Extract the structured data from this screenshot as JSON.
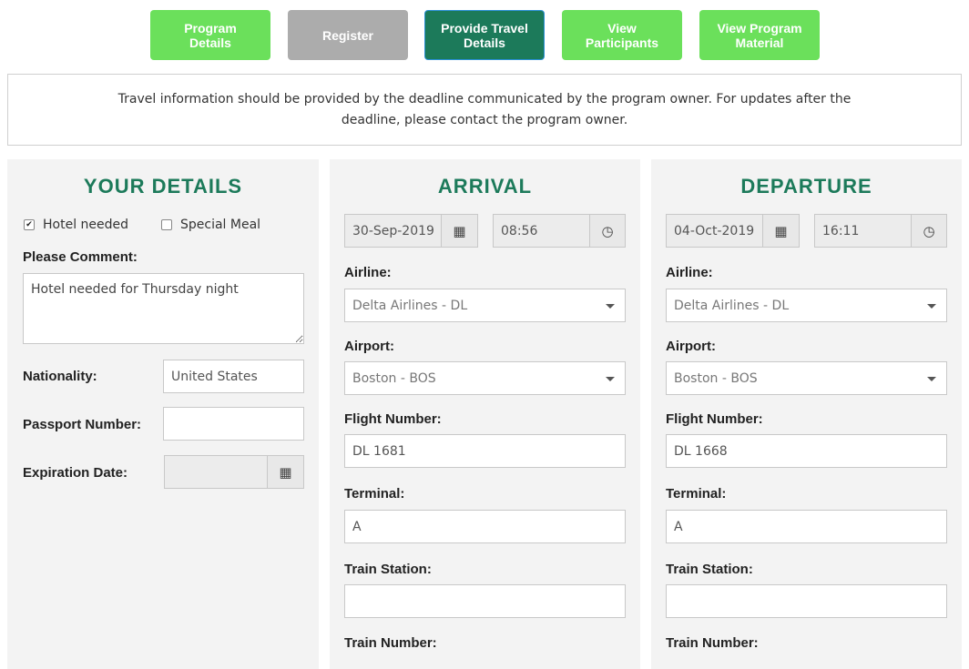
{
  "nav": {
    "program_details": "Program\nDetails",
    "register": "Register",
    "provide_travel": "Provide Travel\nDetails",
    "view_participants": "View\nParticipants",
    "view_material": "View Program\nMaterial"
  },
  "notice": {
    "text": "Travel information should be provided by the deadline communicated by the program owner. For updates after the deadline, please contact the program owner."
  },
  "your_details": {
    "title": "YOUR DETAILS",
    "hotel_label": "Hotel needed",
    "hotel_checked": true,
    "meal_label": "Special Meal",
    "meal_checked": false,
    "comment_label": "Please Comment:",
    "comment_value": "Hotel needed for Thursday night",
    "nationality_label": "Nationality:",
    "nationality_value": "United States",
    "passport_label": "Passport Number:",
    "passport_value": "",
    "expiration_label": "Expiration Date:",
    "expiration_value": ""
  },
  "arrival": {
    "title": "ARRIVAL",
    "date": "30-Sep-2019",
    "time": "08:56",
    "airline_label": "Airline:",
    "airline_value": "Delta Airlines - DL",
    "airport_label": "Airport:",
    "airport_value": "Boston - BOS",
    "flight_label": "Flight Number:",
    "flight_value": "DL 1681",
    "terminal_label": "Terminal:",
    "terminal_value": "A",
    "train_station_label": "Train Station:",
    "train_station_value": "",
    "train_number_label": "Train Number:"
  },
  "departure": {
    "title": "DEPARTURE",
    "date": "04-Oct-2019",
    "time": "16:11",
    "airline_label": "Airline:",
    "airline_value": "Delta Airlines - DL",
    "airport_label": "Airport:",
    "airport_value": "Boston - BOS",
    "flight_label": "Flight Number:",
    "flight_value": "DL 1668",
    "terminal_label": "Terminal:",
    "terminal_value": "A",
    "train_station_label": "Train Station:",
    "train_station_value": "",
    "train_number_label": "Train Number:"
  },
  "icons": {
    "calendar": "calendar-icon",
    "clock": "clock-icon",
    "check": "checkmark"
  },
  "colors": {
    "nav_green": "#6be05b",
    "nav_active": "#1c7a5a",
    "nav_gray": "#acacac",
    "heading": "#1c7a5a",
    "panel_bg": "#f3f3f3"
  }
}
